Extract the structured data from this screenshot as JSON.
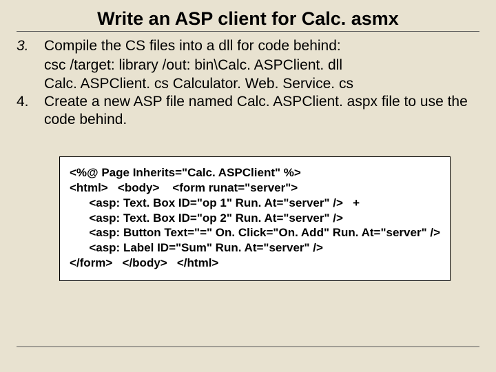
{
  "title": "Write an ASP client for Calc. asmx",
  "steps": {
    "s3": {
      "num": "3.",
      "line1": "Compile the CS files into a dll for code behind:",
      "line2": "csc /target: library /out: bin\\Calc. ASPClient. dll",
      "line3": "Calc. ASPClient. cs Calculator. Web. Service. cs"
    },
    "s4": {
      "num": "4.",
      "text": "Create a new ASP file named Calc. ASPClient. aspx file to use the code behind."
    }
  },
  "code": {
    "l1": "<%@ Page Inherits=\"Calc. ASPClient\" %>",
    "l2": "<html>   <body>    <form runat=\"server\">",
    "l3": "      <asp: Text. Box ID=\"op 1\" Run. At=\"server\" />   +",
    "l4": "      <asp: Text. Box ID=\"op 2\" Run. At=\"server\" />",
    "l5": "      <asp: Button Text=\"=\" On. Click=\"On. Add\" Run. At=\"server\" />",
    "l6": "      <asp: Label ID=\"Sum\" Run. At=\"server\" />",
    "l7": "</form>   </body>   </html>"
  }
}
